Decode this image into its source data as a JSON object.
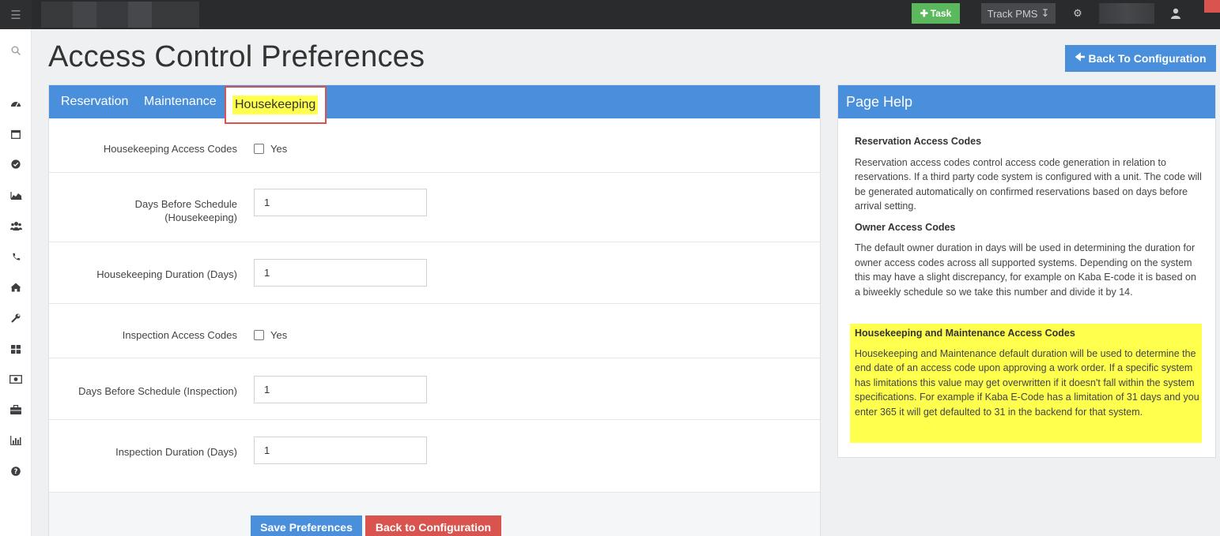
{
  "topbar": {
    "task_label": "Task",
    "track_label": "Track PMS",
    "icons": [
      "menu-icon",
      "plus-icon",
      "download-icon",
      "gear-icon",
      "user-icon"
    ]
  },
  "sidebar": {
    "icons": [
      "search-icon",
      "dashboard-icon",
      "calendar-icon",
      "check-circle-icon",
      "area-chart-icon",
      "users-icon",
      "phone-icon",
      "home-icon",
      "wrench-icon",
      "grid-icon",
      "money-icon",
      "briefcase-icon",
      "bar-chart-icon",
      "question-icon"
    ]
  },
  "page": {
    "title": "Access Control Preferences",
    "back_top_label": "Back To Configuration"
  },
  "tabs": {
    "reservation": "Reservation",
    "maintenance": "Maintenance",
    "housekeeping": "Housekeeping"
  },
  "form": {
    "hk_codes_label": "Housekeeping Access Codes",
    "hk_codes_option": "Yes",
    "days_before_hk_label_1": "Days Before Schedule",
    "days_before_hk_label_2": "(Housekeeping)",
    "days_before_hk_value": "1",
    "hk_duration_label": "Housekeeping Duration (Days)",
    "hk_duration_value": "1",
    "insp_codes_label": "Inspection Access Codes",
    "insp_codes_option": "Yes",
    "days_before_insp_label": "Days Before Schedule (Inspection)",
    "days_before_insp_value": "1",
    "insp_duration_label": "Inspection Duration (Days)",
    "insp_duration_value": "1",
    "save_label": "Save Preferences",
    "back_label": "Back to Configuration"
  },
  "help": {
    "title": "Page Help",
    "res_heading": "Reservation Access Codes",
    "res_text": "Reservation access codes control access code generation in relation to reservations. If a third party code system is configured with a unit. The code will be generated automatically on confirmed reservations based on days before arrival setting.",
    "owner_heading": "Owner Access Codes",
    "owner_text": "The default owner duration in days will be used in determining the duration for owner access codes across all supported systems. Depending on the system this may have a slight discrepancy, for example on Kaba E-code it is based on a biweekly schedule so we take this number and divide it by 14.",
    "hk_heading": "Housekeeping and Maintenance Access Codes",
    "hk_text": "Housekeeping and Maintenance default duration will be used to determine the end date of an access code upon approving a work order. If a specific system has limitations this value may get overwritten if it doesn't fall within the system specifications. For example if Kaba E-Code has a limitation of 31 days and you enter 365 it will get defaulted to 31 in the backend for that system."
  },
  "colors": {
    "accent": "#4a8fdc",
    "danger": "#d9534f",
    "success": "#5cb85c",
    "highlight": "#ffff4d",
    "topbar": "#2a2b2d"
  }
}
